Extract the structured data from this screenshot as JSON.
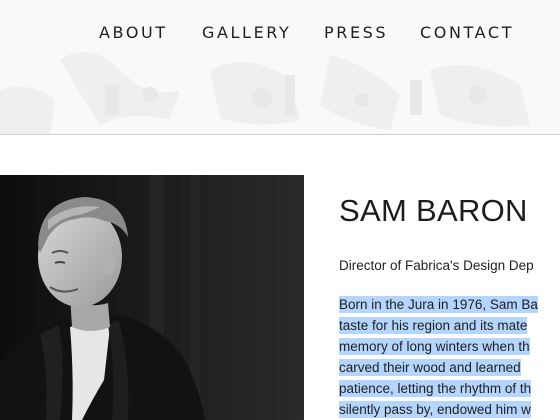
{
  "nav": {
    "items": [
      "ABOUT",
      "GALLERY",
      "PRESS",
      "CONTACT"
    ]
  },
  "profile": {
    "name": "SAM BARON",
    "role": "Director of Fabrica's Design Dep",
    "bio_lines": [
      "Born in the Jura in 1976, Sam Ba",
      "taste for his region and its mate",
      "memory of long winters when th",
      "carved their wood and learned",
      "patience, letting the rhythm of th",
      "silently pass by, endowed him w"
    ]
  },
  "colors": {
    "selection_highlight": "#b4d5fe",
    "header_rule": "#cfcfcf"
  }
}
